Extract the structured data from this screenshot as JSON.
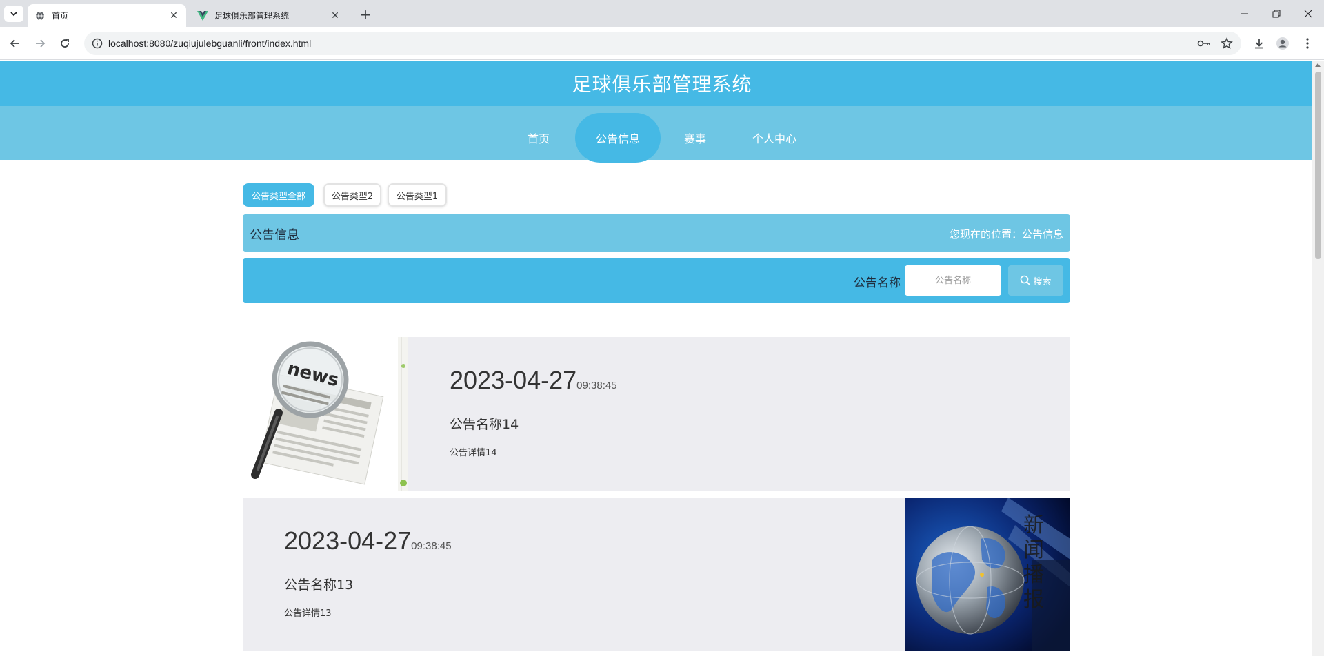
{
  "browser": {
    "tabs": [
      {
        "title": "首页",
        "active": true
      },
      {
        "title": "足球俱乐部管理系统",
        "active": false
      }
    ],
    "url": "localhost:8080/zuqiujulebguanli/front/index.html"
  },
  "site": {
    "title": "足球俱乐部管理系统",
    "nav": [
      {
        "label": "首页",
        "active": false
      },
      {
        "label": "公告信息",
        "active": true
      },
      {
        "label": "赛事",
        "active": false
      },
      {
        "label": "个人中心",
        "active": false
      }
    ]
  },
  "filters": [
    {
      "label": "公告类型全部",
      "active": true
    },
    {
      "label": "公告类型2",
      "active": false
    },
    {
      "label": "公告类型1",
      "active": false
    }
  ],
  "breadcrumb": {
    "title": "公告信息",
    "location": "您现在的位置：公告信息"
  },
  "search": {
    "label": "公告名称",
    "placeholder": "公告名称",
    "button_label": "搜索"
  },
  "news": [
    {
      "date": "2023-04-27",
      "time": "09:38:45",
      "name": "公告名称14",
      "detail": "公告详情14",
      "image": "newspaper-magnifier"
    },
    {
      "date": "2023-04-27",
      "time": "09:38:45",
      "name": "公告名称13",
      "detail": "公告详情13",
      "image": "globe-news-broadcast",
      "image_text": "新闻播报"
    }
  ],
  "colors": {
    "primary": "#45b9e5",
    "secondary": "#6ec6e4",
    "card_bg": "#ededf1"
  }
}
